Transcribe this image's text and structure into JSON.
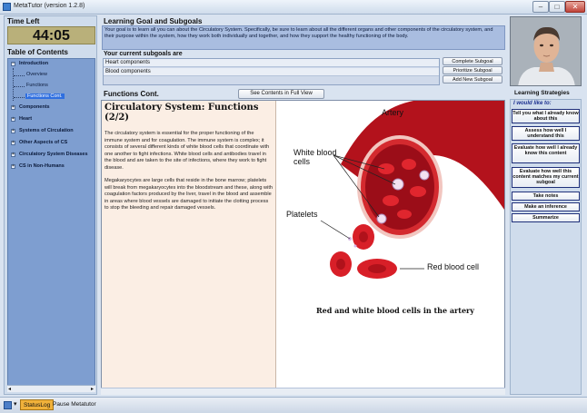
{
  "window": {
    "title": "MetaTutor (version 1.2.8)",
    "minimize": "–",
    "maximize": "□",
    "close": "✕"
  },
  "timer": {
    "label": "Time Left",
    "value": "44:05"
  },
  "toc": {
    "label": "Table of Contents",
    "items": [
      {
        "label": "Introduction",
        "expander": "–"
      },
      {
        "label": "Overview"
      },
      {
        "label": "Functions"
      },
      {
        "label": "Functions Cont."
      },
      {
        "label": "Components",
        "expander": "+"
      },
      {
        "label": "Heart",
        "expander": "+"
      },
      {
        "label": "Systems of Circulation",
        "expander": "+"
      },
      {
        "label": "Other Aspects of CS",
        "expander": "+"
      },
      {
        "label": "Circulatory System Diseases",
        "expander": "+"
      },
      {
        "label": "CS in Non-Humans",
        "expander": "+"
      }
    ],
    "scroll_left": "◂",
    "scroll_right": "▸"
  },
  "goal": {
    "heading": "Learning Goal and Subgoals",
    "text": "Your goal is to learn all you can about the Circulatory System. Specifically, be sure to learn about all the different organs and other components of the circulatory system, and their purpose within the system, how they work both individually and together, and how they support the healthy functioning of the body."
  },
  "subgoals": {
    "heading": "Your current subgoals are",
    "items": [
      "Heart components",
      "Blood components"
    ],
    "buttons": {
      "complete": "Complete Subgoal",
      "prioritize": "Prioritize Subgoal",
      "add": "Add New Subgoal"
    }
  },
  "content": {
    "heading": "Functions Cont.",
    "full_view_button": "See Contents in Full View",
    "title": "Circulatory System: Functions (2/2)",
    "paragraphs": [
      "The circulatory system is essential for the proper functioning of the immune system and for coagulation. The immune system is complex; it consists of several different kinds of white blood cells that coordinate with one another to fight infections. White blood cells and antibodies travel in the blood and are taken to the site of infections, where they work to fight disease.",
      "Megakaryocytes are large cells that reside in the bone marrow; platelets will break from megakaryocytes into the bloodstream and these, along with coagulation factors produced by the liver, travel in the blood and assemble in areas where blood vessels are damaged to initiate the clotting process to stop the bleeding and repair damaged vessels."
    ],
    "image": {
      "labels": {
        "artery": "Artery",
        "white_blood_cells": "White blood cells",
        "platelets": "Platelets",
        "red_blood_cell": "Red blood cell"
      },
      "caption": "Red and white blood cells in the artery"
    }
  },
  "strategies": {
    "heading": "Learning Strategies",
    "prompt": "I would like to:",
    "buttons": [
      "Tell you what I already know about this",
      "Assess how well I understand this",
      "Evaluate how well I already know this content",
      "Evaluate how well this content matches my current subgoal",
      "Take notes",
      "Make an inference",
      "Summarize"
    ]
  },
  "taskbar": {
    "arrow": "▾",
    "status_log": "StatusLog",
    "pause": "Pause Metatutor"
  },
  "colors": {
    "toc_background": "#7e9ed0",
    "goal_background": "#a9bde0",
    "text_pane": "#fbeee4",
    "timer_background": "#b9b07a",
    "accent": "#2f6fe0"
  }
}
